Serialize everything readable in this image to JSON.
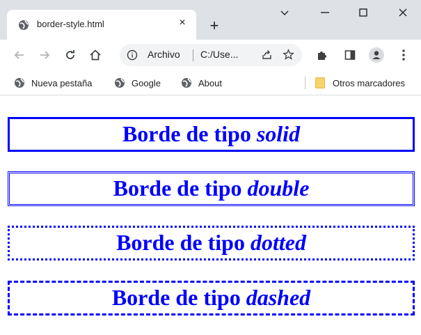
{
  "browser": {
    "tab": {
      "title": "border-style.html",
      "close_label": "×"
    },
    "new_tab_label": "+",
    "window_controls": [
      "chevron-down-icon",
      "minimize-icon",
      "maximize-icon",
      "close-icon"
    ],
    "address_bar": {
      "scheme_label": "Archivo",
      "url": "C:/Use..."
    },
    "bookmarks": [
      {
        "label": "Nueva pestaña",
        "icon": "globe-icon"
      },
      {
        "label": "Google",
        "icon": "globe-icon"
      },
      {
        "label": "About",
        "icon": "globe-icon"
      }
    ],
    "other_bookmarks_label": "Otros marcadores"
  },
  "page": {
    "boxes": [
      {
        "prefix": "Borde de tipo ",
        "style": "solid"
      },
      {
        "prefix": "Borde de tipo ",
        "style": "double"
      },
      {
        "prefix": "Borde de tipo ",
        "style": "dotted"
      },
      {
        "prefix": "Borde de tipo ",
        "style": "dashed"
      }
    ]
  },
  "colors": {
    "text_and_border": "#0000ff",
    "tabstrip_bg": "#dee1e6",
    "omnibox_bg": "#f1f3f4"
  }
}
